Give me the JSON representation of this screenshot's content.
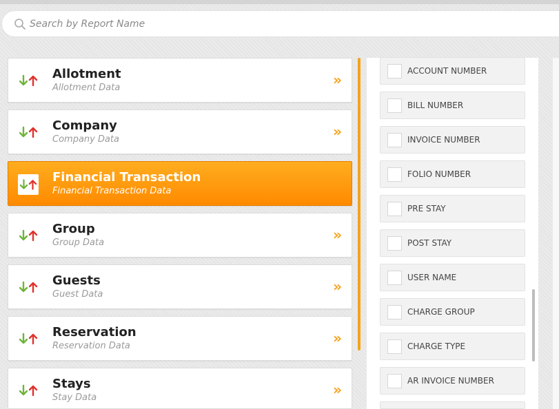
{
  "search": {
    "placeholder": "Search by Report Name"
  },
  "reports": [
    {
      "title": "Allotment",
      "subtitle": "Allotment Data",
      "active": false
    },
    {
      "title": "Company",
      "subtitle": "Company Data",
      "active": false
    },
    {
      "title": "Financial Transaction",
      "subtitle": "Financial Transaction Data",
      "active": true
    },
    {
      "title": "Group",
      "subtitle": "Group Data",
      "active": false
    },
    {
      "title": "Guests",
      "subtitle": "Guest Data",
      "active": false
    },
    {
      "title": "Reservation",
      "subtitle": "Reservation Data",
      "active": false
    },
    {
      "title": "Stays",
      "subtitle": "Stay Data",
      "active": false
    }
  ],
  "chevron": "»",
  "fields": [
    {
      "label": "ACCOUNT NUMBER",
      "checked": false
    },
    {
      "label": "BILL NUMBER",
      "checked": false
    },
    {
      "label": "INVOICE NUMBER",
      "checked": false
    },
    {
      "label": "FOLIO NUMBER",
      "checked": false
    },
    {
      "label": "PRE STAY",
      "checked": false
    },
    {
      "label": "POST STAY",
      "checked": false
    },
    {
      "label": "USER NAME",
      "checked": false
    },
    {
      "label": "CHARGE GROUP",
      "checked": false
    },
    {
      "label": "CHARGE TYPE",
      "checked": false
    },
    {
      "label": "AR INVOICE NUMBER",
      "checked": false
    },
    {
      "label": "",
      "checked": false
    }
  ],
  "colors": {
    "accent": "#f5a21a",
    "arrow_down": "#6fb43a",
    "arrow_up": "#e0312b"
  },
  "icons": {
    "search": "search-icon",
    "sort": "sort-arrows-icon",
    "chevron": "double-chevron-right-icon"
  }
}
